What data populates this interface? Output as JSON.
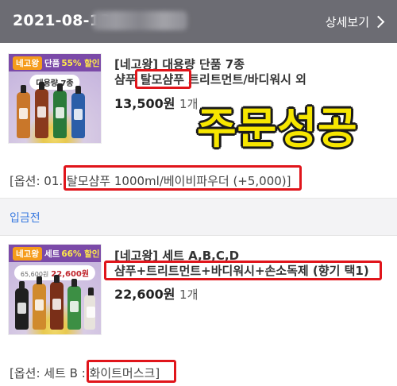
{
  "header": {
    "date": "2021-08-13",
    "detail_label": "상세보기"
  },
  "order1": {
    "thumb": {
      "brand": "네고왕",
      "banner_text": "단품",
      "discount": "55% 할인",
      "pill": "대용량 7종"
    },
    "name_line1": "[네고왕] 대용량 단품 7종",
    "name_line2_prefix": "샴푸 ",
    "name_line2_highlight": "탈모샴푸",
    "name_line2_suffix": " 트리트먼트/바디워시 외",
    "price": "13,500원",
    "qty": "1개",
    "option_prefix": "[옵션: 01. ",
    "option_highlight": "탈모샴푸 1000ml/베이비파우더 (+5,000)",
    "option_suffix": "]"
  },
  "overlay_text": "주문성공",
  "section_label": "입금전",
  "order2": {
    "thumb": {
      "brand": "네고왕",
      "banner_text": "세트",
      "discount": "66% 할인",
      "pill_old": "65,600원",
      "pill_new": "22,600원"
    },
    "name_line1": "[네고왕] 세트 A,B,C,D",
    "name_line2": "샴푸+트리트먼트+바디워시+손소독제 (향기 택1)",
    "price": "22,600원",
    "qty": "1개",
    "option_prefix": "[옵션: 세트 B : ",
    "option_highlight": "화이트머스크",
    "option_suffix": "]"
  },
  "colors": {
    "header_bg": "#6c6c73",
    "highlight_border": "#e0151b",
    "overlay_text": "#f7e600",
    "section_label": "#3b7be0"
  }
}
